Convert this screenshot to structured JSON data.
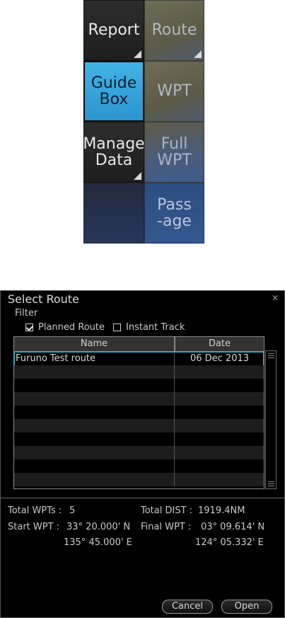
{
  "menu": {
    "tiles": [
      {
        "label": "Report",
        "corner": true
      },
      {
        "label": "Route",
        "corner": true
      },
      {
        "label": "Guide\nBox",
        "corner": false,
        "active": true
      },
      {
        "label": "WPT",
        "corner": false
      },
      {
        "label": "Manage\nData",
        "corner": true
      },
      {
        "label": "Full\nWPT",
        "corner": false
      },
      {
        "label": "",
        "corner": false
      },
      {
        "label": "Pass\n-age",
        "corner": false
      }
    ]
  },
  "dialog": {
    "title": "Select Route",
    "close_icon": "close-icon",
    "filter_label": "Filter",
    "filters": [
      {
        "label": "Planned Route",
        "checked": true
      },
      {
        "label": "Instant Track",
        "checked": false
      }
    ],
    "columns": {
      "name": "Name",
      "date": "Date"
    },
    "rows": [
      {
        "name": "Furuno Test route",
        "date": "06 Dec 2013"
      }
    ],
    "info": {
      "total_wpts_label": "Total WPTs :",
      "total_wpts_value": "5",
      "total_dist_label": "Total DIST :",
      "total_dist_value": "1919.4NM",
      "start_wpt_label": "Start WPT :",
      "start_wpt_lat": "33° 20.000' N",
      "start_wpt_lon": "135° 45.000' E",
      "final_wpt_label": "Final WPT :",
      "final_wpt_lat": "03° 09.614' N",
      "final_wpt_lon": "124° 05.332' E"
    },
    "buttons": {
      "cancel": "Cancel",
      "open": "Open"
    }
  },
  "colors": {
    "active_tile": "#2fa3dc",
    "selection_outline": "#2aa7c9",
    "dialog_bg": "#000000"
  }
}
